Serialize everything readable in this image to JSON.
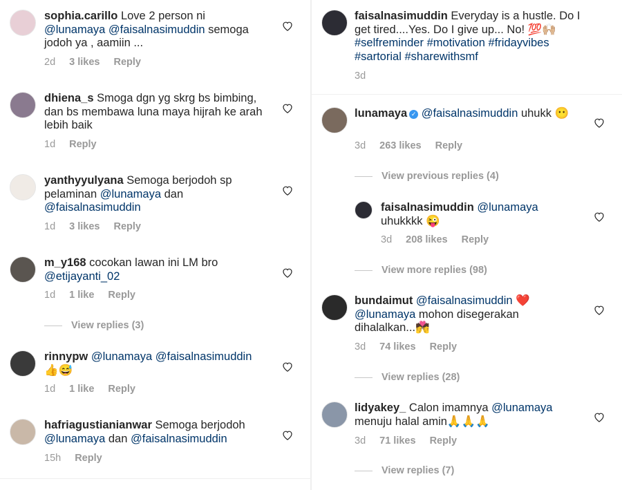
{
  "left": [
    {
      "user": "sophia.carillo",
      "segments": [
        {
          "t": "text",
          "v": " Love 2 person ni "
        },
        {
          "t": "mention",
          "v": "@lunamaya"
        },
        {
          "t": "text",
          "v": " "
        },
        {
          "t": "mention",
          "v": "@faisalnasimuddin"
        },
        {
          "t": "text",
          "v": " semoga jodoh ya , aamiin ..."
        }
      ],
      "time": "2d",
      "likes": "3 likes",
      "reply": "Reply",
      "avatar": "#e8cfd6"
    },
    {
      "user": "dhiena_s",
      "segments": [
        {
          "t": "text",
          "v": " Smoga dgn yg skrg bs bimbing, dan bs membawa luna maya hijrah ke arah lebih baik"
        }
      ],
      "time": "1d",
      "likes": "",
      "reply": "Reply",
      "avatar": "#8a7a8f"
    },
    {
      "user": "yanthyyulyana",
      "segments": [
        {
          "t": "text",
          "v": " Semoga berjodoh sp pelaminan "
        },
        {
          "t": "mention",
          "v": "@lunamaya"
        },
        {
          "t": "text",
          "v": " dan "
        },
        {
          "t": "mention",
          "v": "@faisalnasimuddin"
        }
      ],
      "time": "1d",
      "likes": "3 likes",
      "reply": "Reply",
      "avatar": "#f0ebe6"
    },
    {
      "user": "m_y168",
      "segments": [
        {
          "t": "text",
          "v": " cocokan lawan ini LM bro "
        },
        {
          "t": "mention",
          "v": "@etijayanti_02"
        }
      ],
      "time": "1d",
      "likes": "1 like",
      "reply": "Reply",
      "avatar": "#5a5550",
      "view_replies": "View replies (3)"
    },
    {
      "user": "rinnypw",
      "segments": [
        {
          "t": "text",
          "v": " "
        },
        {
          "t": "mention",
          "v": "@lunamaya"
        },
        {
          "t": "text",
          "v": " "
        },
        {
          "t": "mention",
          "v": "@faisalnasimuddin"
        },
        {
          "t": "text",
          "v": " 👍😅"
        }
      ],
      "time": "1d",
      "likes": "1 like",
      "reply": "Reply",
      "avatar": "#3a3a3a"
    },
    {
      "user": "hafriagustianianwar",
      "segments": [
        {
          "t": "text",
          "v": " Semoga berjodoh "
        },
        {
          "t": "mention",
          "v": "@lunamaya"
        },
        {
          "t": "text",
          "v": " dan "
        },
        {
          "t": "mention",
          "v": "@faisalnasimuddin"
        }
      ],
      "time": "15h",
      "likes": "",
      "reply": "Reply",
      "avatar": "#c9b8a8"
    }
  ],
  "right": {
    "post": {
      "user": "faisalnasimuddin",
      "segments": [
        {
          "t": "text",
          "v": " Everyday is a hustle. Do I get tired....Yes. Do I give up... No! 💯🙌🏼 "
        },
        {
          "t": "tag",
          "v": "#selfreminder"
        },
        {
          "t": "text",
          "v": " "
        },
        {
          "t": "tag",
          "v": "#motivation"
        },
        {
          "t": "text",
          "v": " "
        },
        {
          "t": "tag",
          "v": "#fridayvibes"
        },
        {
          "t": "text",
          "v": " "
        },
        {
          "t": "tag",
          "v": "#sartorial"
        },
        {
          "t": "text",
          "v": " "
        },
        {
          "t": "tag",
          "v": "#sharewithsmf"
        }
      ],
      "time": "3d",
      "avatar": "#2c2c34"
    },
    "c1": {
      "user": "lunamaya",
      "segments": [
        {
          "t": "text",
          "v": " "
        },
        {
          "t": "mention",
          "v": "@faisalnasimuddin"
        },
        {
          "t": "text",
          "v": " uhukk 😶"
        }
      ],
      "time": "3d",
      "likes": "263 likes",
      "reply": "Reply",
      "avatar": "#7a6a5e",
      "prev_replies": "View previous replies (4)"
    },
    "c1_reply": {
      "user": "faisalnasimuddin",
      "segments": [
        {
          "t": "text",
          "v": " "
        },
        {
          "t": "mention",
          "v": "@lunamaya"
        },
        {
          "t": "text",
          "v": " uhukkkk 😜"
        }
      ],
      "time": "3d",
      "likes": "208 likes",
      "reply": "Reply",
      "avatar": "#2c2c34",
      "more_replies": "View more replies (98)"
    },
    "c2": {
      "user": "bundaimut",
      "segments": [
        {
          "t": "text",
          "v": " "
        },
        {
          "t": "mention",
          "v": "@faisalnasimuddin"
        },
        {
          "t": "text",
          "v": " ❤️ "
        },
        {
          "t": "mention",
          "v": "@lunamaya"
        },
        {
          "t": "text",
          "v": "  mohon disegerakan dihalalkan...💏"
        }
      ],
      "time": "3d",
      "likes": "74 likes",
      "reply": "Reply",
      "avatar": "#2a2a2a",
      "view_replies": "View replies (28)"
    },
    "c3": {
      "user": "lidyakey_",
      "segments": [
        {
          "t": "text",
          "v": " Calon imamnya "
        },
        {
          "t": "mention",
          "v": "@lunamaya"
        },
        {
          "t": "text",
          "v": " menuju halal amin🙏🙏🙏"
        }
      ],
      "time": "3d",
      "likes": "71 likes",
      "reply": "Reply",
      "avatar": "#8a96a8",
      "view_replies": "View replies (7)"
    }
  },
  "colors": {
    "text": "#262626",
    "mention": "#003569",
    "meta": "#999999",
    "verified": "#3897f0"
  },
  "icons": {
    "like": "heart-icon",
    "verified": "verified-badge-icon"
  }
}
